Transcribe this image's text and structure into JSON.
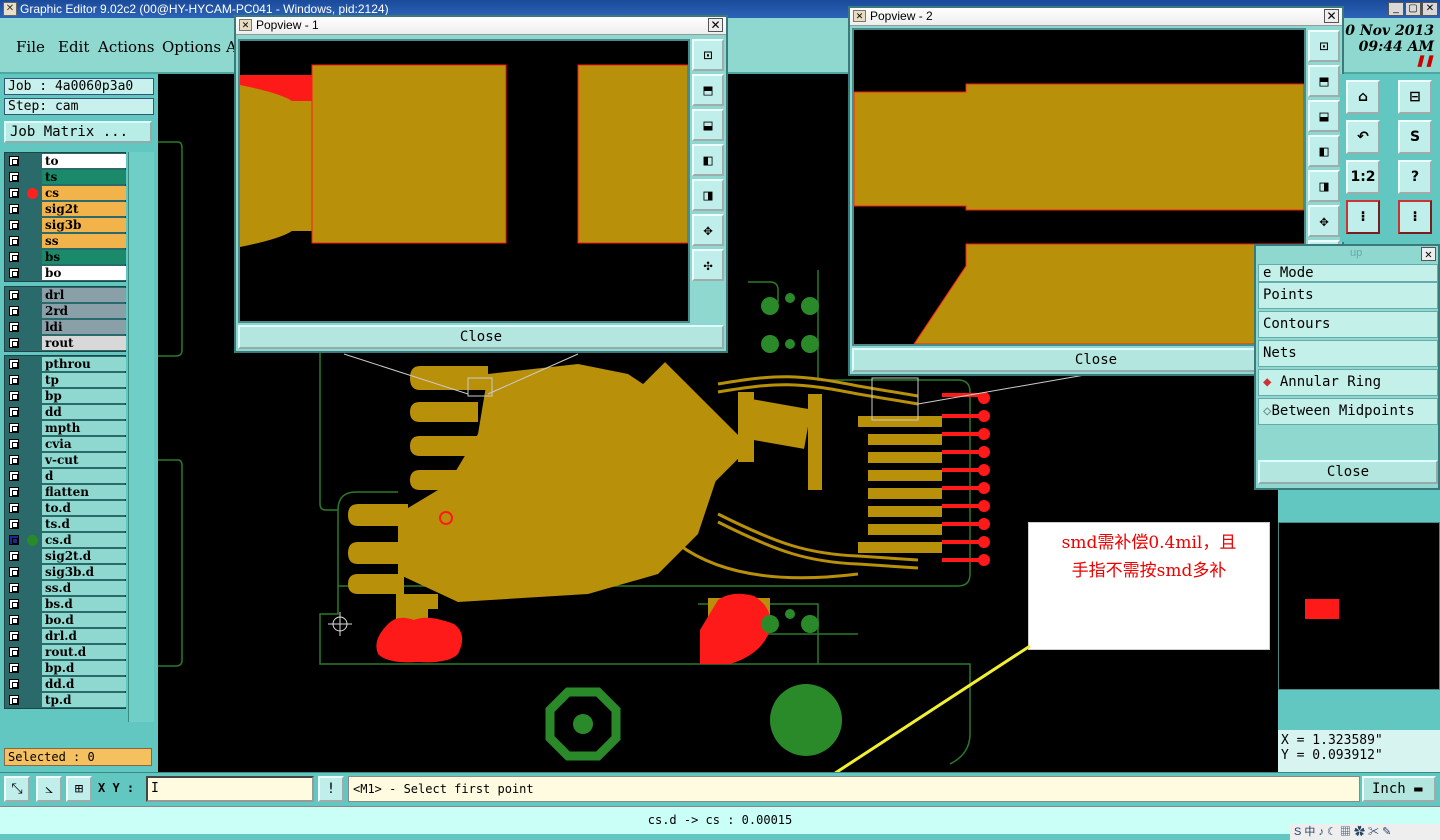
{
  "window": {
    "title": "Graphic Editor 9.02c2 (00@HY-HYCAM-PC041 - Windows, pid:2124)"
  },
  "menu": {
    "items": [
      "File",
      "Edit",
      "Actions",
      "Options",
      "A"
    ]
  },
  "clock": {
    "date": "0 Nov 2013",
    "time": "09:44 AM"
  },
  "job": {
    "job": "Job : 4a0060p3a0",
    "step": "Step: cam",
    "matrix_label": "Job Matrix ..."
  },
  "layers": {
    "board": [
      {
        "name": "to",
        "color": "#ffffff",
        "mark": "✒"
      },
      {
        "name": "ts",
        "color": "#1a8a6a",
        "mark": ""
      },
      {
        "name": "cs",
        "color": "#f2b44a",
        "mark": "✒",
        "dot": "#ff2020"
      },
      {
        "name": "sig2t",
        "color": "#f2b44a",
        "mark": ""
      },
      {
        "name": "sig3b",
        "color": "#f2b44a",
        "mark": ""
      },
      {
        "name": "ss",
        "color": "#f2b44a",
        "mark": ""
      },
      {
        "name": "bs",
        "color": "#1a8a6a",
        "mark": ""
      },
      {
        "name": "bo",
        "color": "#ffffff",
        "mark": "✒"
      }
    ],
    "drill": [
      {
        "name": "drl",
        "color": "#8aa0a8"
      },
      {
        "name": "2rd",
        "color": "#8aa0a8"
      },
      {
        "name": "ldi",
        "color": "#8aa0a8"
      },
      {
        "name": "rout",
        "color": "#d8d8d8"
      }
    ],
    "misc": [
      {
        "name": "pthrou"
      },
      {
        "name": "tp"
      },
      {
        "name": "bp"
      },
      {
        "name": "dd"
      },
      {
        "name": "mpth"
      },
      {
        "name": "cvia"
      },
      {
        "name": "v-cut"
      },
      {
        "name": "d"
      },
      {
        "name": "flatten"
      },
      {
        "name": "to.d",
        "mark": "✒"
      },
      {
        "name": "ts.d"
      },
      {
        "name": "cs.d",
        "mark": "✒⊞",
        "dot": "#2a8a2a",
        "active": true
      },
      {
        "name": "sig2t.d"
      },
      {
        "name": "sig3b.d"
      },
      {
        "name": "ss.d"
      },
      {
        "name": "bs.d"
      },
      {
        "name": "bo.d",
        "mark": "✒"
      },
      {
        "name": "drl.d"
      },
      {
        "name": "rout.d"
      },
      {
        "name": "bp.d"
      },
      {
        "name": "dd.d"
      },
      {
        "name": "tp.d"
      }
    ]
  },
  "selected": "Selected : 0",
  "popview1": {
    "title": "Popview - 1",
    "close": "Close"
  },
  "popview2": {
    "title": "Popview - 2",
    "close": "Close"
  },
  "snap": {
    "header": "up",
    "items": [
      "e Mode",
      "Points",
      "Contours",
      "Nets",
      "Annular Ring",
      "Between Midpoints"
    ],
    "close": "Close"
  },
  "coords": {
    "x": "X = 1.323589\"",
    "y": "Y = 0.093912\""
  },
  "bottom": {
    "xy_label": "X Y :",
    "prompt": "<M1> - Select first point",
    "unit": "Inch"
  },
  "status": "cs.d -> cs : 0.00015",
  "note": {
    "line1": "smd需补偿0.4mil，且",
    "line2": "手指不需按smd多补"
  },
  "tray": "S 中 ♪ ☾ ▦ ✿ ✂ ✎",
  "colors": {
    "copper": "#b8900a",
    "red": "#ff1a1a",
    "green": "#2a8a2a",
    "outline": "#2a7a2a"
  }
}
